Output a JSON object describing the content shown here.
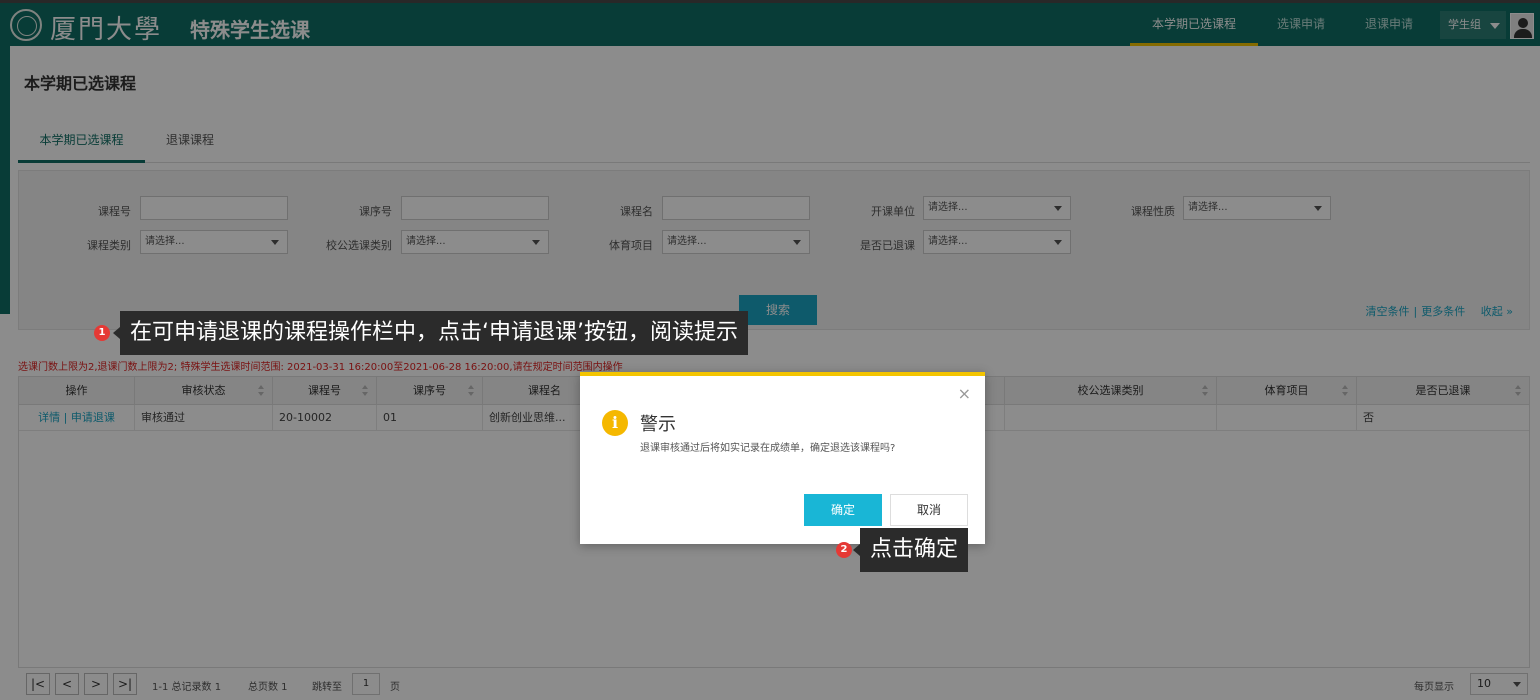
{
  "header": {
    "logo_text": "厦門大學",
    "system_name": "特殊学生选课",
    "nav": [
      {
        "label": "本学期已选课程",
        "active": true
      },
      {
        "label": "选课申请",
        "active": false
      },
      {
        "label": "退课申请",
        "active": false
      }
    ],
    "user_label": "学生组"
  },
  "page": {
    "title": "本学期已选课程",
    "tabs": [
      {
        "label": "本学期已选课程",
        "active": true
      },
      {
        "label": "退课课程",
        "active": false
      }
    ]
  },
  "search": {
    "fields": {
      "course_no": "课程号",
      "class_no": "课序号",
      "course_name": "课程名",
      "dept": "开课单位",
      "nature": "课程性质",
      "category": "课程类别",
      "elective_type": "校公选课类别",
      "sport": "体育项目",
      "withdrawn": "是否已退课"
    },
    "select_placeholder": "请选择...",
    "search_button": "搜索",
    "links": {
      "clear": "清空条件",
      "sep": "|",
      "more": "更多条件",
      "collapse": "收起 »"
    }
  },
  "notice": "选课门数上限为2,退课门数上限为2; 特殊学生选课时间范围: 2021-03-31 16:20:00至2021-06-28 16:20:00,请在规定时间范围内操作",
  "table": {
    "headers": [
      "操作",
      "审核状态",
      "课程号",
      "课序号",
      "课程名",
      "校公选课类别",
      "体育项目",
      "是否已退课"
    ],
    "row": {
      "op_detail": "详情",
      "op_sep": "|",
      "op_withdraw": "申请退课",
      "status": "审核通过",
      "course_no": "20-10002",
      "class_no": "01",
      "course_name": "创新创业思维...",
      "withdrawn": "否"
    }
  },
  "pager": {
    "first": "|<",
    "prev": "<",
    "next": ">",
    "last": ">|",
    "summary": "1-1 总记录数 1",
    "pages": "总页数 1",
    "jump_label": "跳转至",
    "page_value": "1",
    "page_unit": "页",
    "page_size_label": "每页显示",
    "page_size": "10"
  },
  "modal": {
    "close": "×",
    "icon_glyph": "i",
    "title": "警示",
    "message": "退课审核通过后将如实记录在成绩单，确定退选该课程吗?",
    "ok": "确定",
    "cancel": "取消"
  },
  "callouts": {
    "step1_num": "1",
    "step1_text": "在可申请退课的课程操作栏中，点击‘申请退课’按钮，阅读提示",
    "step2_num": "2",
    "step2_text": "点击确定"
  },
  "colors": {
    "header": "#0f6e64",
    "accent_yellow": "#f3c400",
    "button_blue": "#19b6d6",
    "notice_red": "#dd2222",
    "badge_red": "#e53935"
  }
}
